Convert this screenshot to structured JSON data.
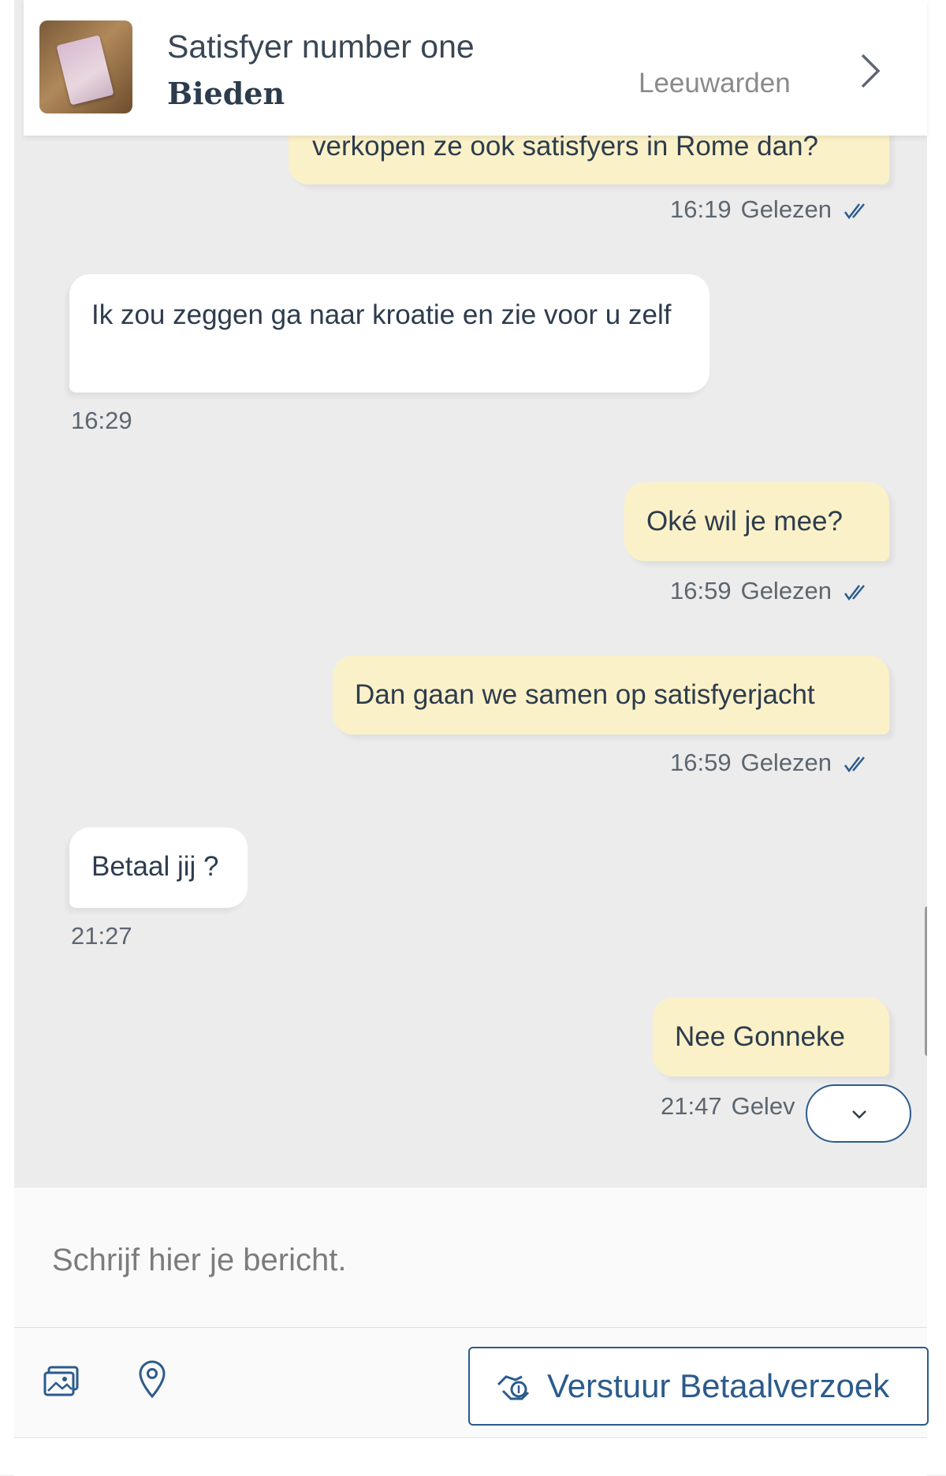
{
  "header": {
    "ad_title": "Satisfyer number one",
    "ad_action": "Bieden",
    "location": "Leeuwarden",
    "thumbnail_icon": "product-thumbnail",
    "chevron_icon": "chevron-right-icon"
  },
  "messages": [
    {
      "direction": "outgoing",
      "text": "verkopen ze ook satisfyers in Rome dan?",
      "time": "16:19",
      "status": "Gelezen"
    },
    {
      "direction": "incoming",
      "text": "Ik zou zeggen ga naar kroatie en zie voor u zelf",
      "time": "16:29"
    },
    {
      "direction": "outgoing",
      "text": "Oké wil je mee?",
      "time": "16:59",
      "status": "Gelezen"
    },
    {
      "direction": "outgoing",
      "text": "Dan gaan we samen op satisfyerjacht",
      "time": "16:59",
      "status": "Gelezen"
    },
    {
      "direction": "incoming",
      "text": "Betaal jij ?",
      "time": "21:27"
    },
    {
      "direction": "outgoing",
      "text": "Nee Gonneke",
      "time": "21:47",
      "status": "Gelev"
    }
  ],
  "composer": {
    "placeholder": "Schrijf hier je bericht."
  },
  "toolbar": {
    "pay_request_label": "Verstuur Betaalverzoek",
    "photo_icon": "photo-icon",
    "location_icon": "location-pin-icon",
    "pay_icon": "payment-hand-icon"
  },
  "colors": {
    "outgoing_bubble": "#fbf1c8",
    "incoming_bubble": "#ffffff",
    "accent": "#2b5b8c",
    "chat_background": "#ececec"
  }
}
